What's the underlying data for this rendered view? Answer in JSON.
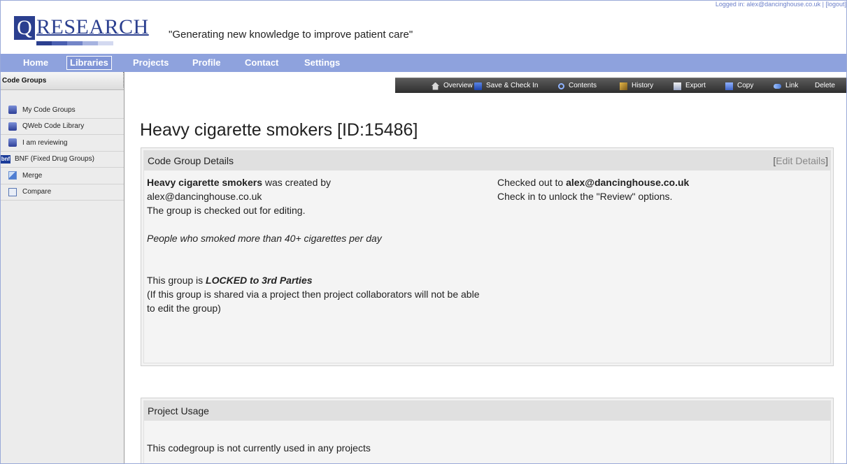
{
  "header": {
    "logo_q": "Q",
    "logo_word": "RESEARCH",
    "tagline": "\"Generating new knowledge to improve patient care\"",
    "login_text": "Logged in: alex@dancinghouse.co.uk | [logout]"
  },
  "nav": {
    "items": [
      "Home",
      "Libraries",
      "Projects",
      "Profile",
      "Contact",
      "Settings"
    ],
    "active": "Libraries"
  },
  "sidebar": {
    "title": "Code Groups",
    "items": [
      {
        "label": "My Code Groups",
        "icon": "database-icon"
      },
      {
        "label": "QWeb Code Library",
        "icon": "database-icon"
      },
      {
        "label": "I am reviewing",
        "icon": "database-icon"
      },
      {
        "label": "BNF (Fixed Drug Groups)",
        "icon": "bnf-icon",
        "icon_text": "bnf"
      },
      {
        "label": "Merge",
        "icon": "merge-icon"
      },
      {
        "label": "Compare",
        "icon": "compare-icon"
      }
    ]
  },
  "toolbar": {
    "items": [
      "Overview",
      "Save & Check In",
      "Contents",
      "History",
      "Export",
      "Copy",
      "Link",
      "Delete"
    ]
  },
  "page": {
    "title": "Heavy cigarette smokers [ID:15486]"
  },
  "details": {
    "header": "Code Group Details",
    "edit_bracket_open": "[",
    "edit_label": "Edit Details",
    "edit_bracket_close": "]",
    "group_name": "Heavy cigarette smokers",
    "created_by_text": " was created by",
    "creator": "alex@dancinghouse.co.uk",
    "checked_out_text": "The group is checked out for editing.",
    "description": "People who smoked more than 40+ cigarettes per day",
    "lock_prefix": "This group is ",
    "lock_status": "LOCKED to 3rd Parties",
    "lock_note": "(If this group is shared via a project then project collaborators will not be able to edit the group)",
    "checked_out_to_prefix": "Checked out to ",
    "checked_out_to": "alex@dancinghouse.co.uk",
    "review_hint": "Check in to unlock the \"Review\" options."
  },
  "usage": {
    "header": "Project Usage",
    "text": "This codegroup is not currently used in any projects"
  },
  "colors": {
    "nav_bg": "#8ea2dd",
    "brand": "#2b3f8f",
    "toolbar_bg": "#3a3a3a"
  }
}
